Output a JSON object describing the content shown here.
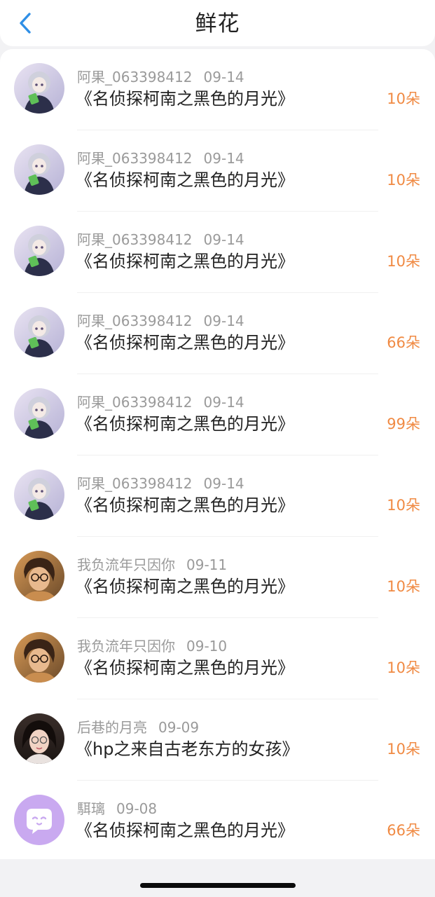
{
  "header": {
    "title": "鲜花",
    "back_icon": "chevron-left-icon",
    "accent": "#2f8fe6"
  },
  "colors": {
    "amount": "#f08a43",
    "meta": "#9a9a9a",
    "title": "#222222"
  },
  "rows": [
    {
      "user": "阿果_063398412",
      "date": "09-14",
      "book": "《名侦探柯南之黑色的月光》",
      "amount": "10朵",
      "avatar": "anime-girl"
    },
    {
      "user": "阿果_063398412",
      "date": "09-14",
      "book": "《名侦探柯南之黑色的月光》",
      "amount": "10朵",
      "avatar": "anime-girl"
    },
    {
      "user": "阿果_063398412",
      "date": "09-14",
      "book": "《名侦探柯南之黑色的月光》",
      "amount": "10朵",
      "avatar": "anime-girl"
    },
    {
      "user": "阿果_063398412",
      "date": "09-14",
      "book": "《名侦探柯南之黑色的月光》",
      "amount": "66朵",
      "avatar": "anime-girl"
    },
    {
      "user": "阿果_063398412",
      "date": "09-14",
      "book": "《名侦探柯南之黑色的月光》",
      "amount": "99朵",
      "avatar": "anime-girl"
    },
    {
      "user": "阿果_063398412",
      "date": "09-14",
      "book": "《名侦探柯南之黑色的月光》",
      "amount": "10朵",
      "avatar": "anime-girl"
    },
    {
      "user": "我负流年只因你",
      "date": "09-11",
      "book": "《名侦探柯南之黑色的月光》",
      "amount": "10朵",
      "avatar": "glasses-person"
    },
    {
      "user": "我负流年只因你",
      "date": "09-10",
      "book": "《名侦探柯南之黑色的月光》",
      "amount": "10朵",
      "avatar": "glasses-person"
    },
    {
      "user": "后巷的月亮",
      "date": "09-09",
      "book": "《hp之来自古老东方的女孩》",
      "amount": "10朵",
      "avatar": "dark-hair-girl"
    },
    {
      "user": "駬璃",
      "date": "09-08",
      "book": "《名侦探柯南之黑色的月光》",
      "amount": "66朵",
      "avatar": "default-purple"
    }
  ]
}
